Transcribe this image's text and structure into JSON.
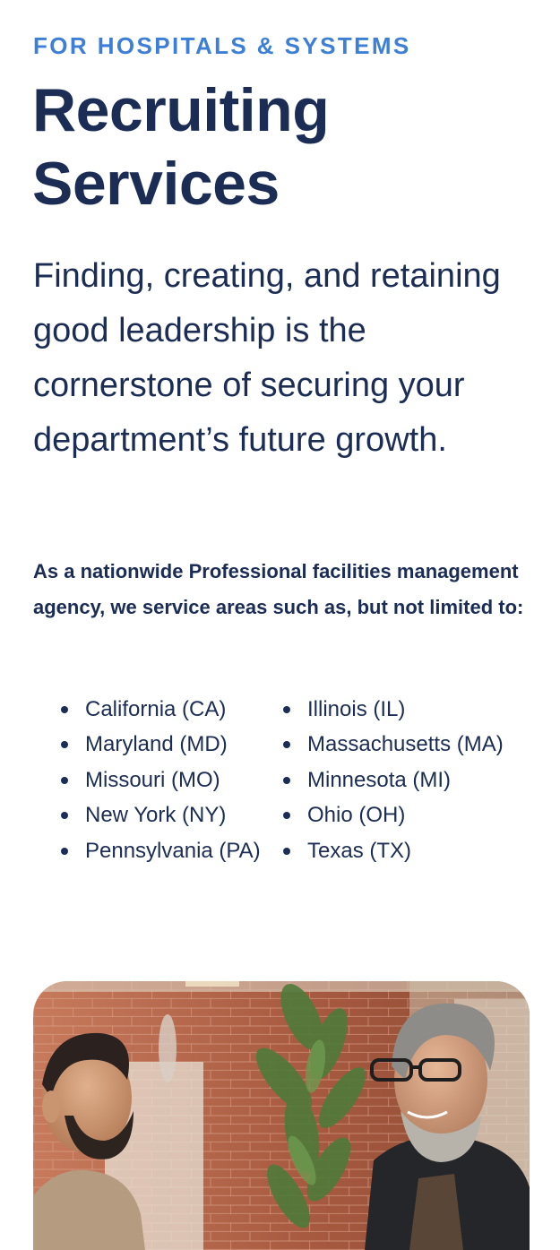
{
  "section": {
    "eyebrow": "FOR HOSPITALS & SYSTEMS",
    "title": "Recruiting Services",
    "lead": "Finding, creating, and retaining good leadership is the cornerstone of securing your department’s future growth.",
    "intro": "As a nationwide Professional facilities management agency, we service areas such as, but not limited to:"
  },
  "states": [
    "California (CA)",
    "Maryland (MD)",
    "Missouri (MO)",
    "New York (NY)",
    "Pennsylvania (PA)",
    "Illinois (IL)",
    "Massachusetts (MA)",
    "Minnesota (MI)",
    "Ohio (OH)",
    "Texas (TX)"
  ],
  "colors": {
    "eyebrow": "#3d7fd6",
    "heading": "#1b2d55"
  }
}
